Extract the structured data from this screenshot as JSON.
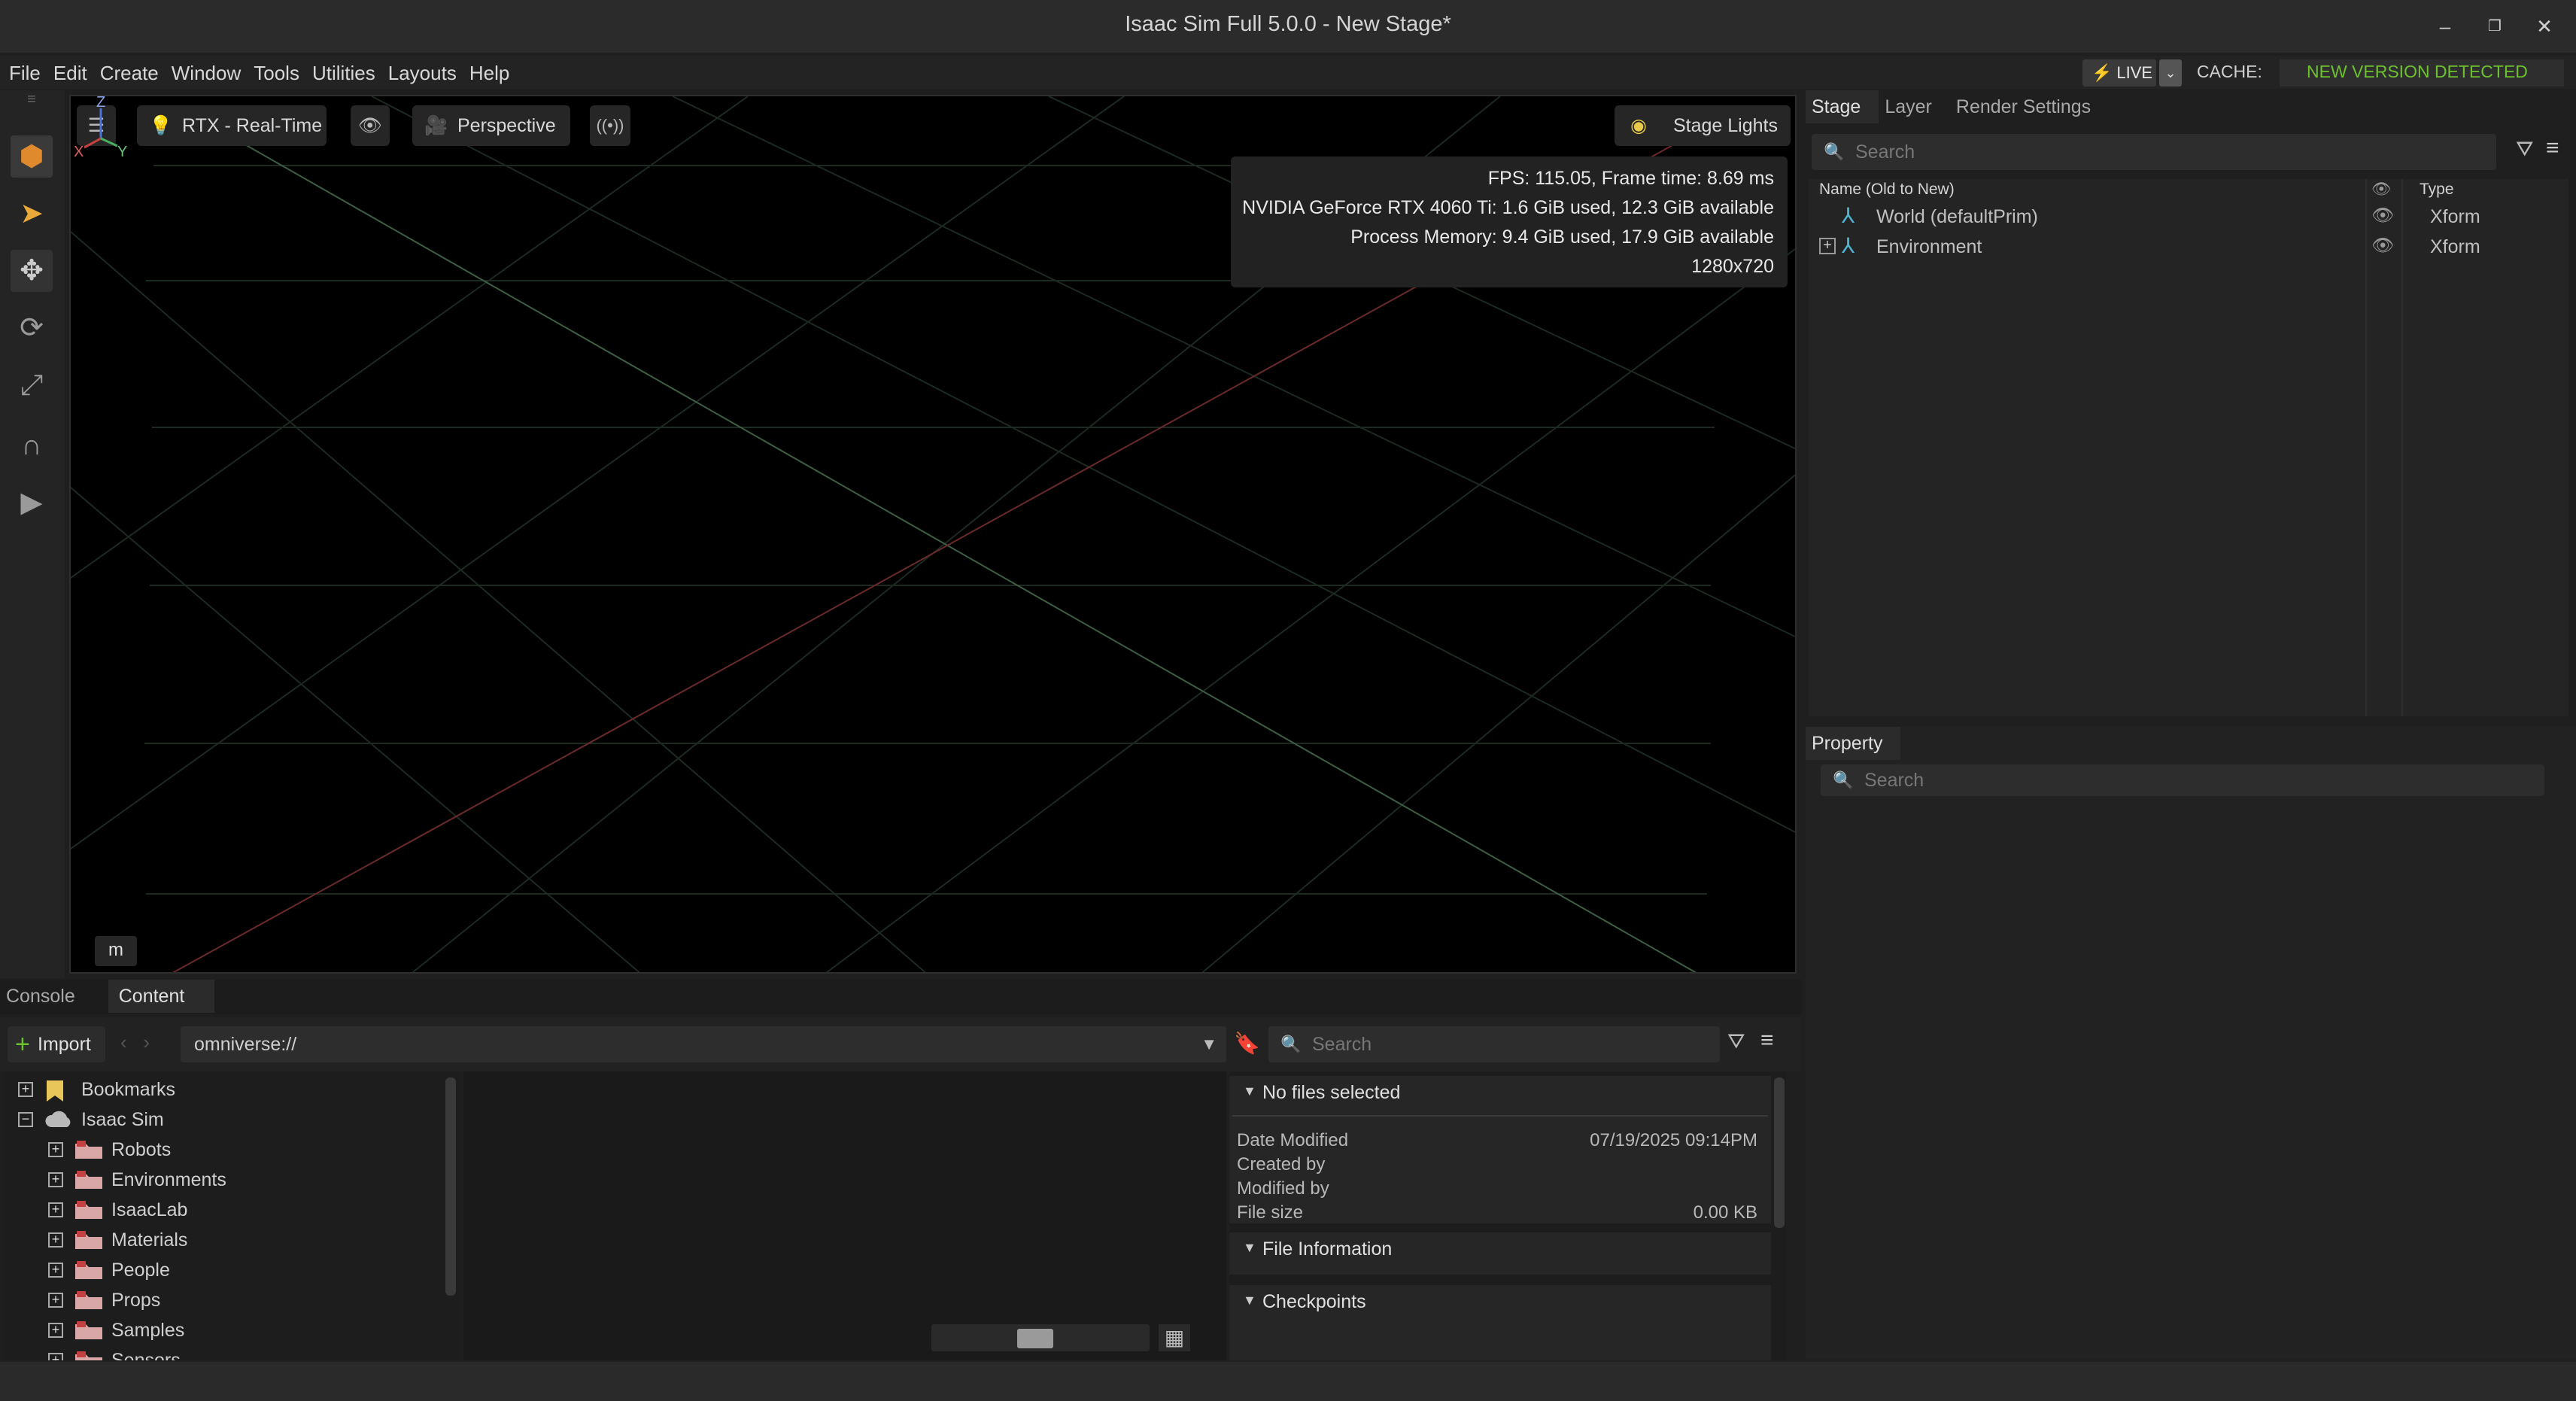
{
  "window": {
    "title": "Isaac Sim Full 5.0.0 - New Stage*",
    "controls": [
      "minimize-icon",
      "restore-icon",
      "close-icon"
    ]
  },
  "menubar": {
    "items": [
      "File",
      "Edit",
      "Create",
      "Window",
      "Tools",
      "Utilities",
      "Layouts",
      "Help"
    ],
    "live_label": "LIVE",
    "cache_label": "CACHE:",
    "version_notice": "NEW VERSION DETECTED",
    "accent_green": "#6ec12e"
  },
  "left_toolbar": {
    "tools": [
      "select-mode-icon",
      "pointer-icon",
      "move-icon",
      "rotate-icon",
      "scale-icon",
      "snap-magnet-icon",
      "play-icon"
    ]
  },
  "viewport": {
    "render_mode": "RTX - Real-Time",
    "camera": "Perspective",
    "lights": "Stage Lights",
    "stats": {
      "fps": "FPS: 115.05, Frame time: 8.69 ms",
      "gpu": "NVIDIA GeForce RTX 4060 Ti: 1.6 GiB used, 12.3 GiB available",
      "process_memory": "Process Memory: 9.4 GiB used, 17.9 GiB available",
      "resolution": "1280x720"
    },
    "axis_labels": {
      "z": "Z",
      "x": "X",
      "y": "Y"
    },
    "unit": "m"
  },
  "stage_panel": {
    "tabs": [
      "Stage",
      "Layer",
      "Render Settings"
    ],
    "active_tab": "Stage",
    "search_placeholder": "Search",
    "columns": {
      "name": "Name (Old to New)",
      "type": "Type"
    },
    "rows": [
      {
        "name": "World (defaultPrim)",
        "type": "Xform",
        "expandable": false
      },
      {
        "name": "Environment",
        "type": "Xform",
        "expandable": true
      }
    ]
  },
  "property_panel": {
    "tab": "Property",
    "search_placeholder": "Search"
  },
  "bottom_panel": {
    "tabs": [
      "Console",
      "Content"
    ],
    "active_tab": "Content",
    "import_label": "Import",
    "path": "omniverse://",
    "search_placeholder": "Search",
    "tree": [
      {
        "label": "Bookmarks",
        "level": 0,
        "expand": "+",
        "icon": "bookmark-icon"
      },
      {
        "label": "Isaac Sim",
        "level": 0,
        "expand": "−",
        "icon": "cloud-icon"
      },
      {
        "label": "Robots",
        "level": 1,
        "expand": "+",
        "icon": "folder-icon"
      },
      {
        "label": "Environments",
        "level": 1,
        "expand": "+",
        "icon": "folder-icon"
      },
      {
        "label": "IsaacLab",
        "level": 1,
        "expand": "+",
        "icon": "folder-icon"
      },
      {
        "label": "Materials",
        "level": 1,
        "expand": "+",
        "icon": "folder-icon"
      },
      {
        "label": "People",
        "level": 1,
        "expand": "+",
        "icon": "folder-icon"
      },
      {
        "label": "Props",
        "level": 1,
        "expand": "+",
        "icon": "folder-icon"
      },
      {
        "label": "Samples",
        "level": 1,
        "expand": "+",
        "icon": "folder-icon"
      },
      {
        "label": "Sensors",
        "level": 1,
        "expand": "+",
        "icon": "folder-icon"
      }
    ],
    "info": {
      "header": "No files selected",
      "date_modified_label": "Date Modified",
      "date_modified_value": "07/19/2025 09:14PM",
      "created_by_label": "Created by",
      "modified_by_label": "Modified by",
      "file_size_label": "File size",
      "file_size_value": "0.00 KB",
      "file_information": "File Information",
      "checkpoints": "Checkpoints"
    }
  }
}
